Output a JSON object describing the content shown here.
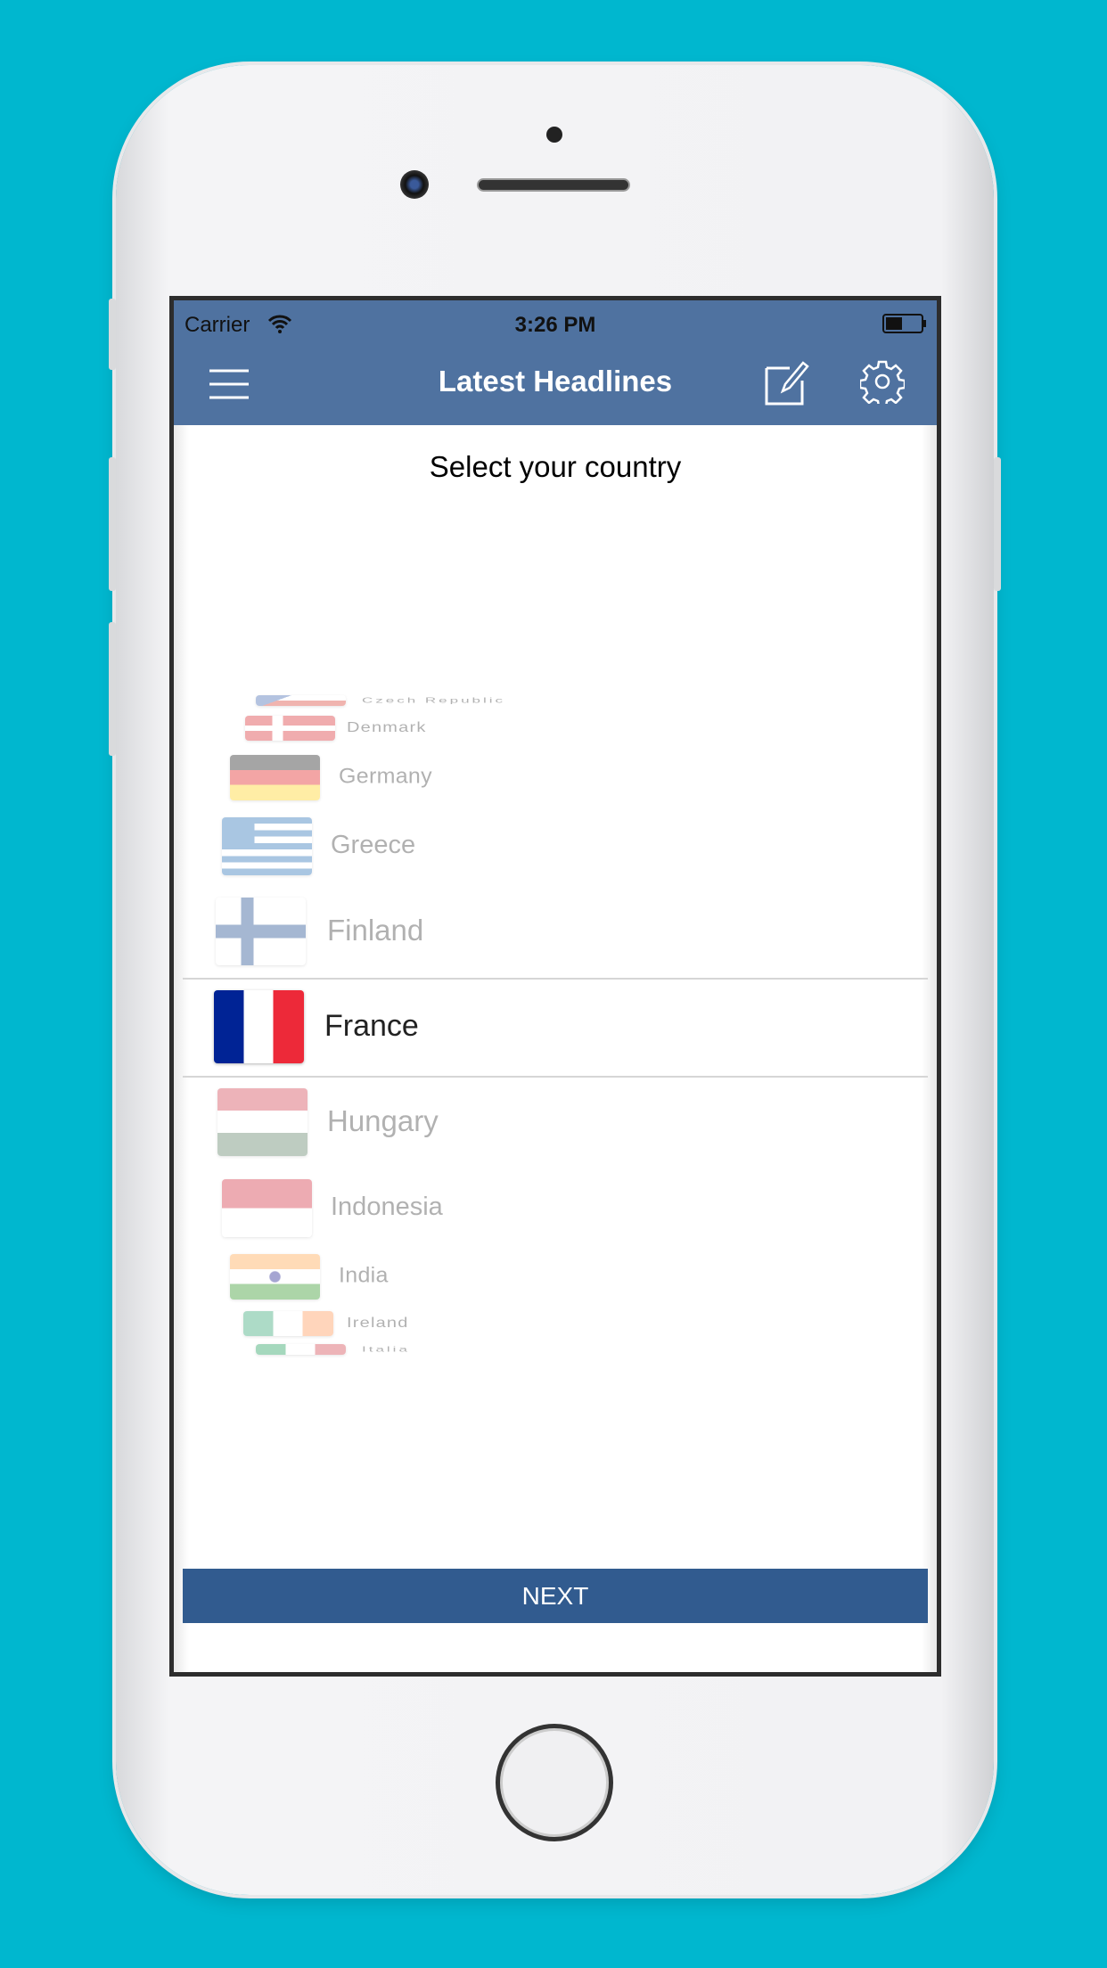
{
  "status_bar": {
    "carrier": "Carrier",
    "time": "3:26 PM"
  },
  "nav": {
    "title": "Latest Headlines"
  },
  "prompt": "Select your country",
  "picker": {
    "selected": "France",
    "countries": [
      {
        "name": "Czech Republic",
        "flag": "cz"
      },
      {
        "name": "Denmark",
        "flag": "dk"
      },
      {
        "name": "Germany",
        "flag": "de"
      },
      {
        "name": "Greece",
        "flag": "gr"
      },
      {
        "name": "Finland",
        "flag": "fi"
      },
      {
        "name": "France",
        "flag": "fr"
      },
      {
        "name": "Hungary",
        "flag": "hu"
      },
      {
        "name": "Indonesia",
        "flag": "id"
      },
      {
        "name": "India",
        "flag": "in"
      },
      {
        "name": "Ireland",
        "flag": "ie"
      },
      {
        "name": "Italia",
        "flag": "it"
      }
    ]
  },
  "next_label": "NEXT",
  "colors": {
    "background": "#00b7cf",
    "nav": "#4f72a0",
    "button": "#315b8f"
  }
}
